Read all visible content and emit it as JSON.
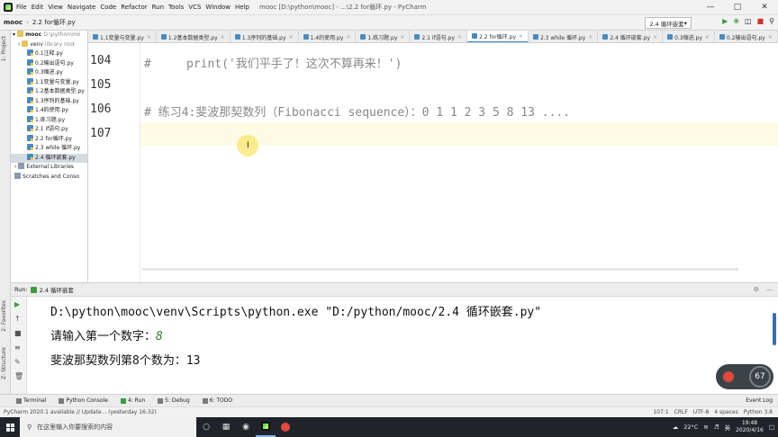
{
  "menubar": {
    "items": [
      "File",
      "Edit",
      "View",
      "Navigate",
      "Code",
      "Refactor",
      "Run",
      "Tools",
      "VCS",
      "Window",
      "Help"
    ],
    "window_title": "mooc [D:\\python\\mooc] - ...\\2.2 for循环.py - PyCharm"
  },
  "navbar": {
    "project": "mooc",
    "file": "2.2 for循环.py",
    "run_config": "2.4 循环嵌套"
  },
  "project_panel": {
    "label": "1: Project",
    "root": "mooc",
    "root_hint": "D:\\python\\mo",
    "venv": "venv",
    "venv_hint": "library root",
    "files": [
      "0.1注释.py",
      "0.2输出语句.py",
      "0.3缩进.py",
      "1.1变量与变量.py",
      "1.2基本数据类型.py",
      "1.3序列的基础.py",
      "1.4的使用.py",
      "1.练习题.py",
      "2.1 if语句.py",
      "2.2 for循环.py",
      "2.3 while 循环.py",
      "2.4 循环嵌套.py"
    ],
    "selected_file": "2.4 循环嵌套.py",
    "external": "External Libraries",
    "scratches": "Scratches and Conso"
  },
  "tabs": [
    "1.1变量与变量.py",
    "1.2基本数据类型.py",
    "1.3序列的基础.py",
    "1.4的使用.py",
    "1.练习题.py",
    "2.1 if语句.py",
    "2.2 for循环.py",
    "2.3 while 循环.py",
    "2.4 循环嵌套.py",
    "0.3缩进.py",
    "0.2输出语句.py"
  ],
  "active_tab": "2.2 for循环.py",
  "editor": {
    "lines": [
      {
        "num": "104",
        "code": "#     print('我们平手了！这次不算再来！')"
      },
      {
        "num": "105",
        "code": ""
      },
      {
        "num": "106",
        "code": "# 练习4:斐波那契数列（Fibonacci sequence）：0 1 1 2 3 5 8 13 ...."
      },
      {
        "num": "107",
        "code": ""
      }
    ]
  },
  "run_panel": {
    "tab_label": "Run:",
    "config": "2.4 循环嵌套",
    "console": {
      "command": "D:\\python\\mooc\\venv\\Scripts\\python.exe \"D:/python/mooc/2.4 循环嵌套.py\"",
      "prompt": "请输入第一个数字：",
      "input_value": "8",
      "result": "斐波那契数列第8个数为：13"
    }
  },
  "overlay": {
    "percent": "67"
  },
  "bottom_tools": [
    "Terminal",
    "Python Console",
    "4: Run",
    "5: Debug",
    "6: TODO"
  ],
  "event_log": "Event Log",
  "statusbar": {
    "message": "PyCharm 2020.1 available // Update... (yesterday 16:32)",
    "position": "107:1",
    "line_sep": "CRLF",
    "encoding": "UTF-8",
    "indent": "4 spaces",
    "interpreter": "Python 3.8"
  },
  "taskbar": {
    "search_placeholder": "在这里输入你要搜索的内容",
    "weather": "22°C",
    "ime": "英",
    "time": "19:48",
    "date": "2020/4/16"
  },
  "side_labels": {
    "favorites": "2: Favorites",
    "structure": "Z: Structure"
  },
  "colors": {
    "accent": "#4083c9",
    "current_line": "#fdfbe3",
    "run_green": "#3c9b3c"
  }
}
